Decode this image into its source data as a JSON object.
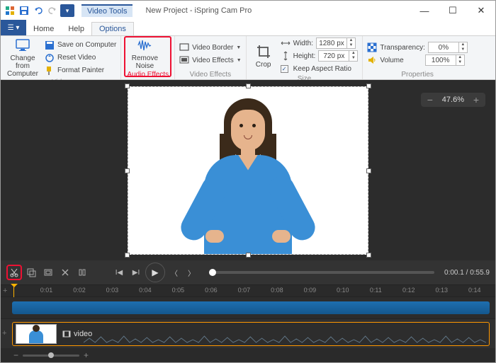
{
  "title": "New Project - iSpring Cam Pro",
  "context_tab": "Video Tools",
  "tabs": {
    "home": "Home",
    "help": "Help",
    "options": "Options"
  },
  "ribbon": {
    "video": {
      "label": "Video",
      "change_from_computer": "Change from Computer",
      "save_on_computer": "Save on Computer",
      "reset_video": "Reset Video",
      "format_painter": "Format Painter"
    },
    "audio_effects": {
      "label": "Audio Effects",
      "remove_noise": "Remove Noise"
    },
    "video_effects": {
      "label": "Video Effects",
      "video_border": "Video Border",
      "video_effects": "Video Effects"
    },
    "size": {
      "label": "Size",
      "crop": "Crop",
      "width_label": "Width:",
      "width_value": "1280 px",
      "height_label": "Height:",
      "height_value": "720 px",
      "keep_aspect": "Keep Aspect Ratio"
    },
    "properties": {
      "label": "Properties",
      "transparency_label": "Transparency:",
      "transparency_value": "0%",
      "volume_label": "Volume",
      "volume_value": "100%"
    }
  },
  "zoom_level": "47.6%",
  "playback": {
    "time_current": "0:00.1",
    "time_total": "0:55.9"
  },
  "ruler_ticks": [
    "0:01",
    "0:02",
    "0:03",
    "0:04",
    "0:05",
    "0:06",
    "0:07",
    "0:08",
    "0:09",
    "0:10",
    "0:11",
    "0:12",
    "0:13",
    "0:14"
  ],
  "clip": {
    "label": "video"
  },
  "icons": {
    "scissors": "scissors",
    "play": "play"
  }
}
